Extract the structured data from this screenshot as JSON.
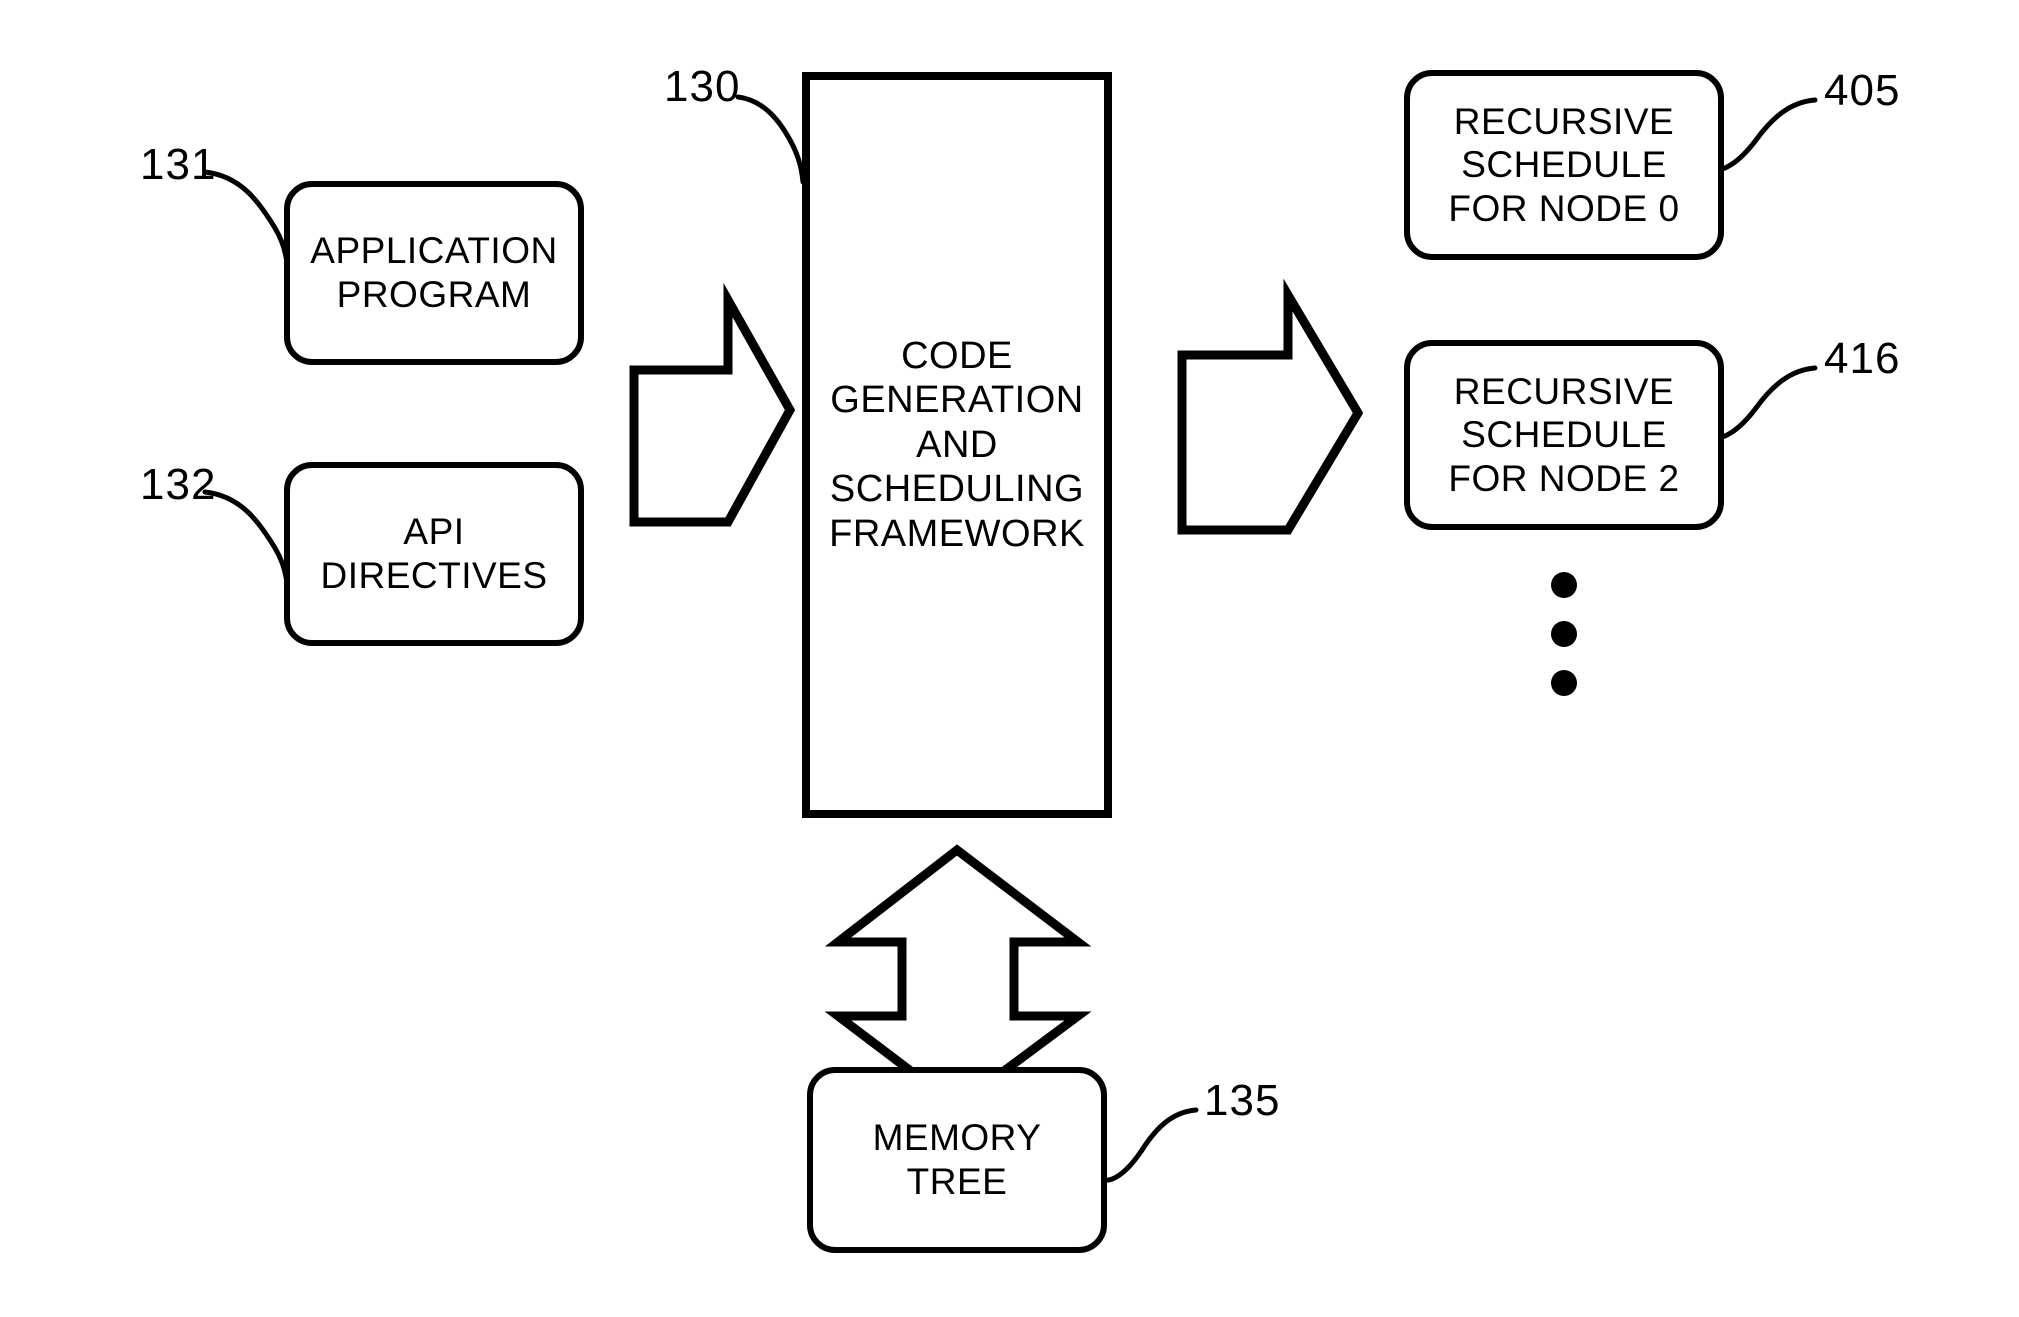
{
  "figure": {
    "title": "Code generation and scheduling framework block diagram",
    "stroke_color": "#000000",
    "background_color": "#ffffff"
  },
  "inputs": [
    {
      "id": "application-program",
      "ref": "131",
      "lines": [
        "APPLICATION",
        "PROGRAM"
      ]
    },
    {
      "id": "api-directives",
      "ref": "132",
      "lines": [
        "API",
        "DIRECTIVES"
      ]
    }
  ],
  "processor": {
    "id": "code-generation-and-scheduling-framework",
    "ref": "130",
    "lines": [
      "CODE",
      "GENERATION",
      "AND",
      "SCHEDULING",
      "FRAMEWORK"
    ]
  },
  "outputs": [
    {
      "id": "recursive-schedule-node-0",
      "ref": "405",
      "lines": [
        "RECURSIVE",
        "SCHEDULE",
        "FOR NODE 0"
      ]
    },
    {
      "id": "recursive-schedule-node-2",
      "ref": "416",
      "lines": [
        "RECURSIVE",
        "SCHEDULE",
        "FOR NODE 2"
      ]
    }
  ],
  "storage": {
    "id": "memory-tree",
    "ref": "135",
    "lines": [
      "MEMORY",
      "TREE"
    ]
  },
  "ellipsis": {
    "count": 3,
    "meaning": "additional recursive schedules continue"
  },
  "arrows": [
    {
      "id": "inputs-to-framework",
      "direction": "right",
      "style": "hollow-block"
    },
    {
      "id": "framework-to-outputs",
      "direction": "right",
      "style": "hollow-block"
    },
    {
      "id": "framework-to-memory-tree",
      "direction": "both",
      "style": "hollow-block"
    }
  ]
}
